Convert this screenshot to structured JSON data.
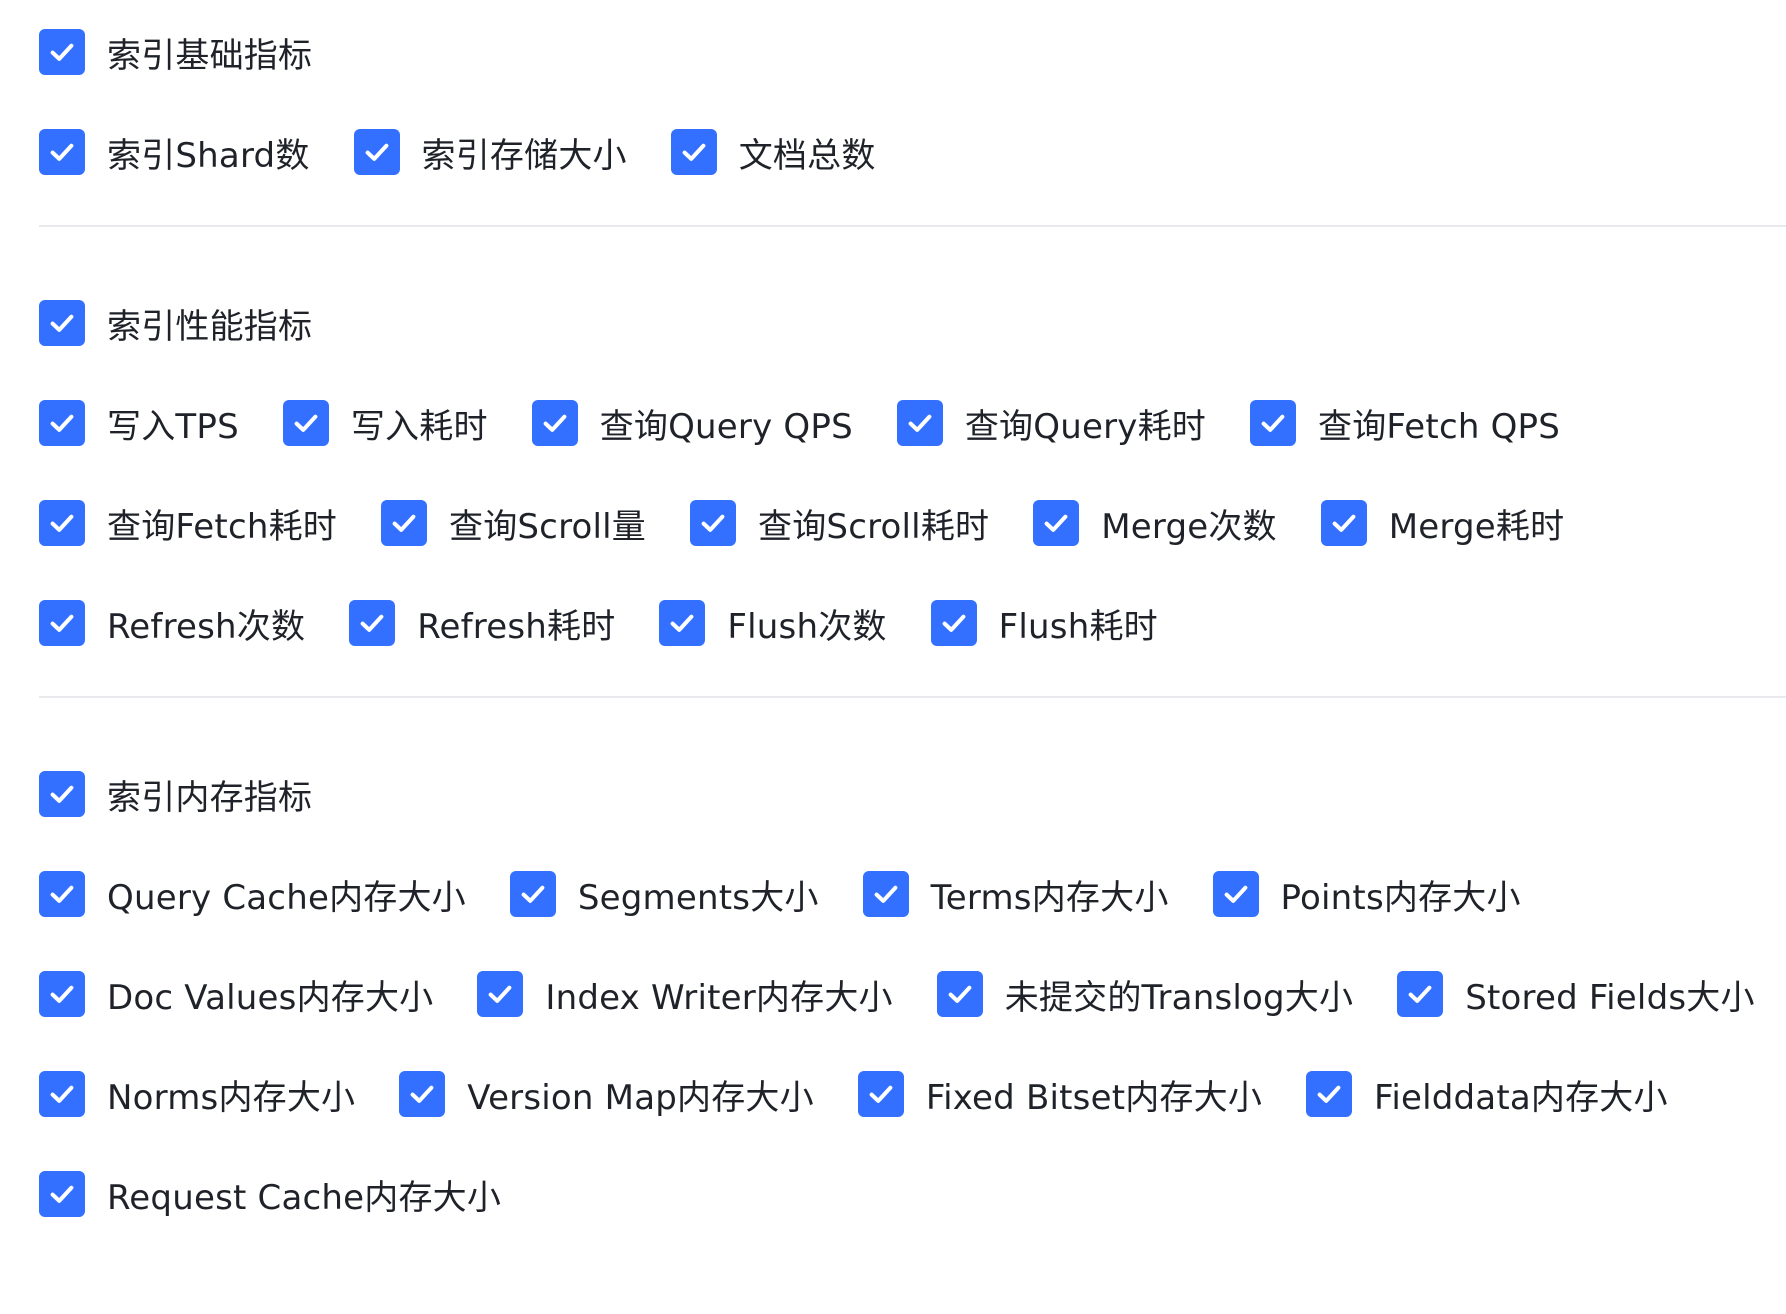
{
  "icon_name": "checkmark-icon",
  "accent_color": "#3370ff",
  "sections": [
    {
      "key": "basic",
      "group": {
        "label": "索引基础指标",
        "checked": true
      },
      "rows": [
        [
          {
            "label": "索引Shard数",
            "checked": true
          },
          {
            "label": "索引存储大小",
            "checked": true
          },
          {
            "label": "文档总数",
            "checked": true
          }
        ]
      ]
    },
    {
      "key": "performance",
      "group": {
        "label": "索引性能指标",
        "checked": true
      },
      "rows": [
        [
          {
            "label": "写入TPS",
            "checked": true
          },
          {
            "label": "写入耗时",
            "checked": true
          },
          {
            "label": "查询Query QPS",
            "checked": true
          },
          {
            "label": "查询Query耗时",
            "checked": true
          },
          {
            "label": "查询Fetch QPS",
            "checked": true
          }
        ],
        [
          {
            "label": "查询Fetch耗时",
            "checked": true
          },
          {
            "label": "查询Scroll量",
            "checked": true
          },
          {
            "label": "查询Scroll耗时",
            "checked": true
          },
          {
            "label": "Merge次数",
            "checked": true
          },
          {
            "label": "Merge耗时",
            "checked": true
          }
        ],
        [
          {
            "label": "Refresh次数",
            "checked": true
          },
          {
            "label": "Refresh耗时",
            "checked": true
          },
          {
            "label": "Flush次数",
            "checked": true
          },
          {
            "label": "Flush耗时",
            "checked": true
          }
        ]
      ]
    },
    {
      "key": "memory",
      "group": {
        "label": "索引内存指标",
        "checked": true
      },
      "rows": [
        [
          {
            "label": "Query Cache内存大小",
            "checked": true
          },
          {
            "label": "Segments大小",
            "checked": true
          },
          {
            "label": "Terms内存大小",
            "checked": true
          },
          {
            "label": "Points内存大小",
            "checked": true
          }
        ],
        [
          {
            "label": "Doc Values内存大小",
            "checked": true
          },
          {
            "label": "Index Writer内存大小",
            "checked": true
          },
          {
            "label": "未提交的Translog大小",
            "checked": true
          },
          {
            "label": "Stored Fields大小",
            "checked": true
          }
        ],
        [
          {
            "label": "Norms内存大小",
            "checked": true
          },
          {
            "label": "Version Map内存大小",
            "checked": true
          },
          {
            "label": "Fixed Bitset内存大小",
            "checked": true
          },
          {
            "label": "Fielddata内存大小",
            "checked": true
          }
        ],
        [
          {
            "label": "Request Cache内存大小",
            "checked": true
          }
        ]
      ]
    }
  ]
}
